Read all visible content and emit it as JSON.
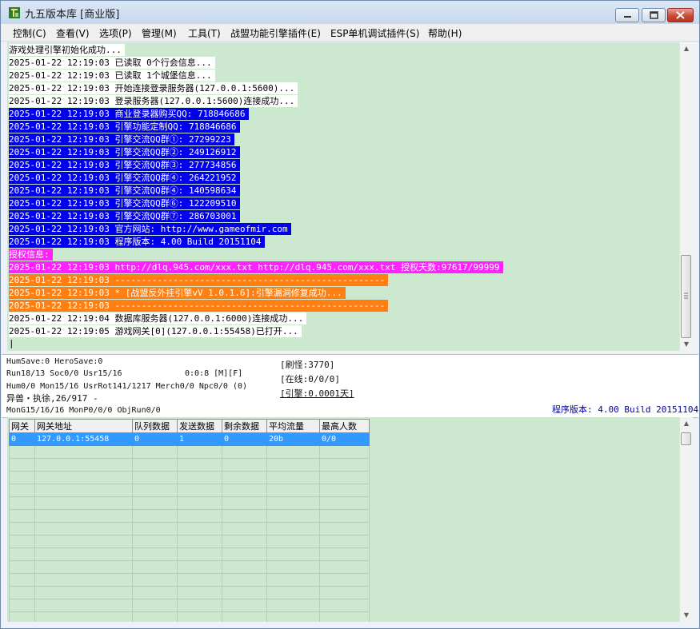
{
  "window": {
    "title": "九五版本库 [商业版]"
  },
  "menu": [
    "控制(C)",
    "查看(V)",
    "选项(P)",
    "管理(M)",
    "工具(T)",
    "战盟功能引擎插件(E)",
    "ESP单机调试插件(S)",
    "帮助(H)"
  ],
  "colors": {
    "log_bg": "#cce8cf",
    "blue": "#0000ee",
    "magenta": "#ff22ff",
    "orange": "#ff7f12",
    "selection": "#3399ff"
  },
  "log": [
    {
      "text": "游戏处理引擎初始化成功...",
      "color": "white"
    },
    {
      "text": "2025-01-22 12:19:03 已读取 0个行会信息...",
      "color": "white"
    },
    {
      "text": "2025-01-22 12:19:03 已读取 1个城堡信息...",
      "color": "white"
    },
    {
      "text": "2025-01-22 12:19:03 开始连接登录服务器(127.0.0.1:5600)...",
      "color": "white"
    },
    {
      "text": "2025-01-22 12:19:03 登录服务器(127.0.0.1:5600)连接成功...",
      "color": "white"
    },
    {
      "text": "2025-01-22 12:19:03 商业登录器购买QQ: 718846686",
      "color": "blue"
    },
    {
      "text": "2025-01-22 12:19:03 引擎功能定制QQ: 718846686",
      "color": "blue"
    },
    {
      "text": "2025-01-22 12:19:03 引擎交流QQ群①: 27299223",
      "color": "blue"
    },
    {
      "text": "2025-01-22 12:19:03 引擎交流QQ群②: 249126912",
      "color": "blue"
    },
    {
      "text": "2025-01-22 12:19:03 引擎交流QQ群③: 277734856",
      "color": "blue"
    },
    {
      "text": "2025-01-22 12:19:03 引擎交流QQ群④: 264221952",
      "color": "blue"
    },
    {
      "text": "2025-01-22 12:19:03 引擎交流QQ群④: 140598634",
      "color": "blue"
    },
    {
      "text": "2025-01-22 12:19:03 引擎交流QQ群⑥: 122209510",
      "color": "blue"
    },
    {
      "text": "2025-01-22 12:19:03 引擎交流QQ群⑦: 286703001",
      "color": "blue"
    },
    {
      "text": "2025-01-22 12:19:03 官方网站: http://www.gameofmir.com",
      "color": "blue"
    },
    {
      "text": "2025-01-22 12:19:03 程序版本: 4.00 Build 20151104",
      "color": "blue"
    },
    {
      "text": "授权信息:",
      "color": "magenta"
    },
    {
      "text": "2025-01-22 12:19:03 http://dlq.945.com/xxx.txt http://dlq.945.com/xxx.txt 授权天数:97617/99999",
      "color": "magenta"
    },
    {
      "text": "2025-01-22 12:19:03 ---------------------------------------------------",
      "color": "orange"
    },
    {
      "text": "2025-01-22 12:19:03 * [战盟反外挂引擎vV 1.0.1.6]:引擎漏洞修复成功...",
      "color": "orange"
    },
    {
      "text": "2025-01-22 12:19:03 ---------------------------------------------------",
      "color": "orange"
    },
    {
      "text": "2025-01-22 12:19:04 数据库服务器(127.0.0.1:6000)连接成功...",
      "color": "white"
    },
    {
      "text": "2025-01-22 12:19:05 游戏网关[0](127.0.0.1:55458)已打开...",
      "color": "white"
    },
    {
      "text": "|",
      "color": "none"
    }
  ],
  "status": {
    "line1": "HumSave:0 HeroSave:0",
    "line2": "Run18/13 Soc0/0 Usr15/16",
    "line2b": "0:0:8 [M][F]",
    "line3": "Hum0/0 Mon15/16 UsrRot141/1217 Merch0/0 Npc0/0 (0)",
    "line4": "异兽・执徐,26/917 -",
    "line5": "MonG15/16/16 MonP0/0/0 ObjRun0/0",
    "refresh": "[刷怪:3770]",
    "online": "[在线:0/0/0]",
    "engine": "[引擎:0.0001天]",
    "version": "程序版本: 4.00 Build 20151104"
  },
  "gateway_table": {
    "columns": [
      "网关",
      "网关地址",
      "队列数据",
      "发送数据",
      "剩余数据",
      "平均流量",
      "最高人数"
    ],
    "rows": [
      [
        "0",
        "127.0.0.1:55458",
        "0",
        "1",
        "0",
        "20b",
        "0/0"
      ]
    ]
  }
}
